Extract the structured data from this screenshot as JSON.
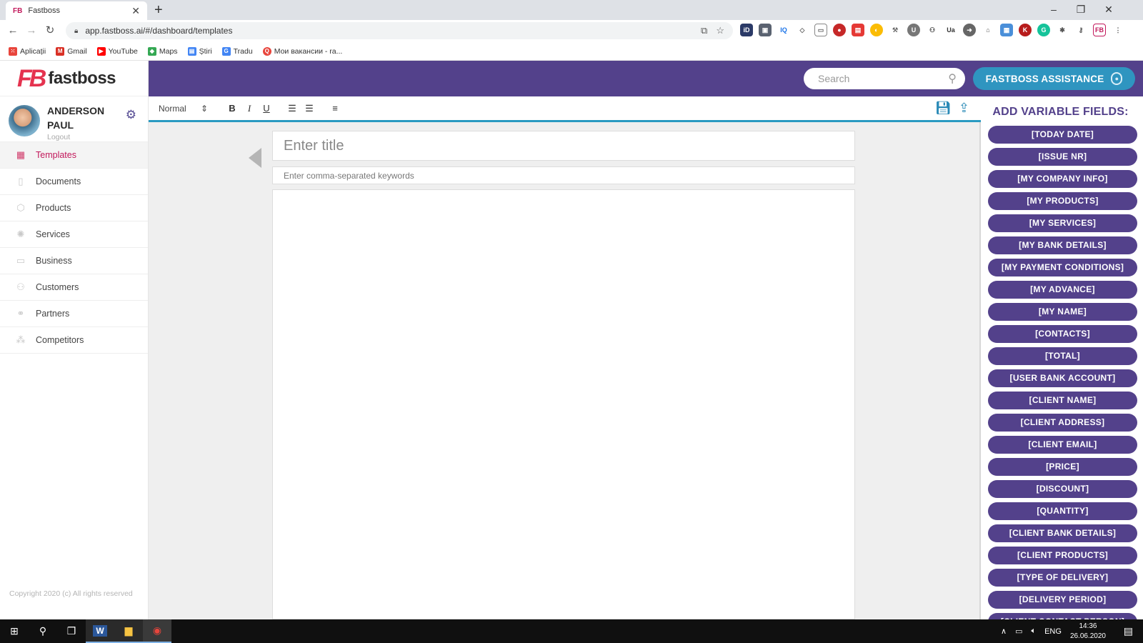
{
  "browser": {
    "tab_title": "Fastboss",
    "tab_favicon": "FB",
    "url": "app.fastboss.ai/#/dashboard/templates",
    "bookmarks": [
      {
        "label": "Aplicații",
        "icon": "apps-grid-icon",
        "color": "#e8453c"
      },
      {
        "label": "Gmail",
        "icon": "gmail-icon",
        "color": "#d93025"
      },
      {
        "label": "YouTube",
        "icon": "youtube-icon",
        "color": "#ff0000"
      },
      {
        "label": "Maps",
        "icon": "maps-icon",
        "color": "#34a853"
      },
      {
        "label": "Știri",
        "icon": "news-icon",
        "color": "#4285f4"
      },
      {
        "label": "Tradu",
        "icon": "translate-icon",
        "color": "#4285f4"
      },
      {
        "label": "Мои вакансии - ra...",
        "icon": "job-search-icon",
        "color": "#e8453c"
      }
    ]
  },
  "app": {
    "logo_mark": "FB",
    "logo_text": "fastboss",
    "user": {
      "name": "ANDERSON PAUL",
      "logout": "Logout"
    },
    "nav": [
      {
        "label": "Templates",
        "icon": "templates-icon",
        "active": true
      },
      {
        "label": "Documents",
        "icon": "documents-icon"
      },
      {
        "label": "Products",
        "icon": "products-icon"
      },
      {
        "label": "Services",
        "icon": "services-icon"
      },
      {
        "label": "Business",
        "icon": "business-icon"
      },
      {
        "label": "Customers",
        "icon": "customers-icon"
      },
      {
        "label": "Partners",
        "icon": "partners-icon"
      },
      {
        "label": "Competitors",
        "icon": "competitors-icon"
      }
    ],
    "copyright": "Copyright 2020 (c) All rights reserved",
    "search_placeholder": "Search",
    "assistant_label": "FASTBOSS ASSISTANCE",
    "colors": {
      "primary": "#53418b",
      "accent": "#2f95c0",
      "active_nav": "#c2185b"
    }
  },
  "editor": {
    "format_select": "Normal",
    "title_placeholder": "Enter title",
    "keywords_placeholder": "Enter comma-separated keywords"
  },
  "variables": {
    "heading": "ADD VARIABLE FIELDS:",
    "items": [
      "[TODAY DATE]",
      "[ISSUE NR]",
      "[MY COMPANY INFO]",
      "[MY PRODUCTS]",
      "[MY SERVICES]",
      "[MY BANK DETAILS]",
      "[MY PAYMENT CONDITIONS]",
      "[MY ADVANCE]",
      "[MY NAME]",
      "[CONTACTS]",
      "[TOTAL]",
      "[USER BANK ACCOUNT]",
      "[CLIENT NAME]",
      "[CLIENT ADDRESS]",
      "[CLIENT EMAIL]",
      "[PRICE]",
      "[DISCOUNT]",
      "[QUANTITY]",
      "[CLIENT BANK DETAILS]",
      "[CLIENT PRODUCTS]",
      "[TYPE OF DELIVERY]",
      "[DELIVERY PERIOD]",
      "[CLIENT CONTACT PERSON]"
    ]
  },
  "taskbar": {
    "language": "ENG",
    "time": "14:36",
    "date": "26.06.2020"
  }
}
